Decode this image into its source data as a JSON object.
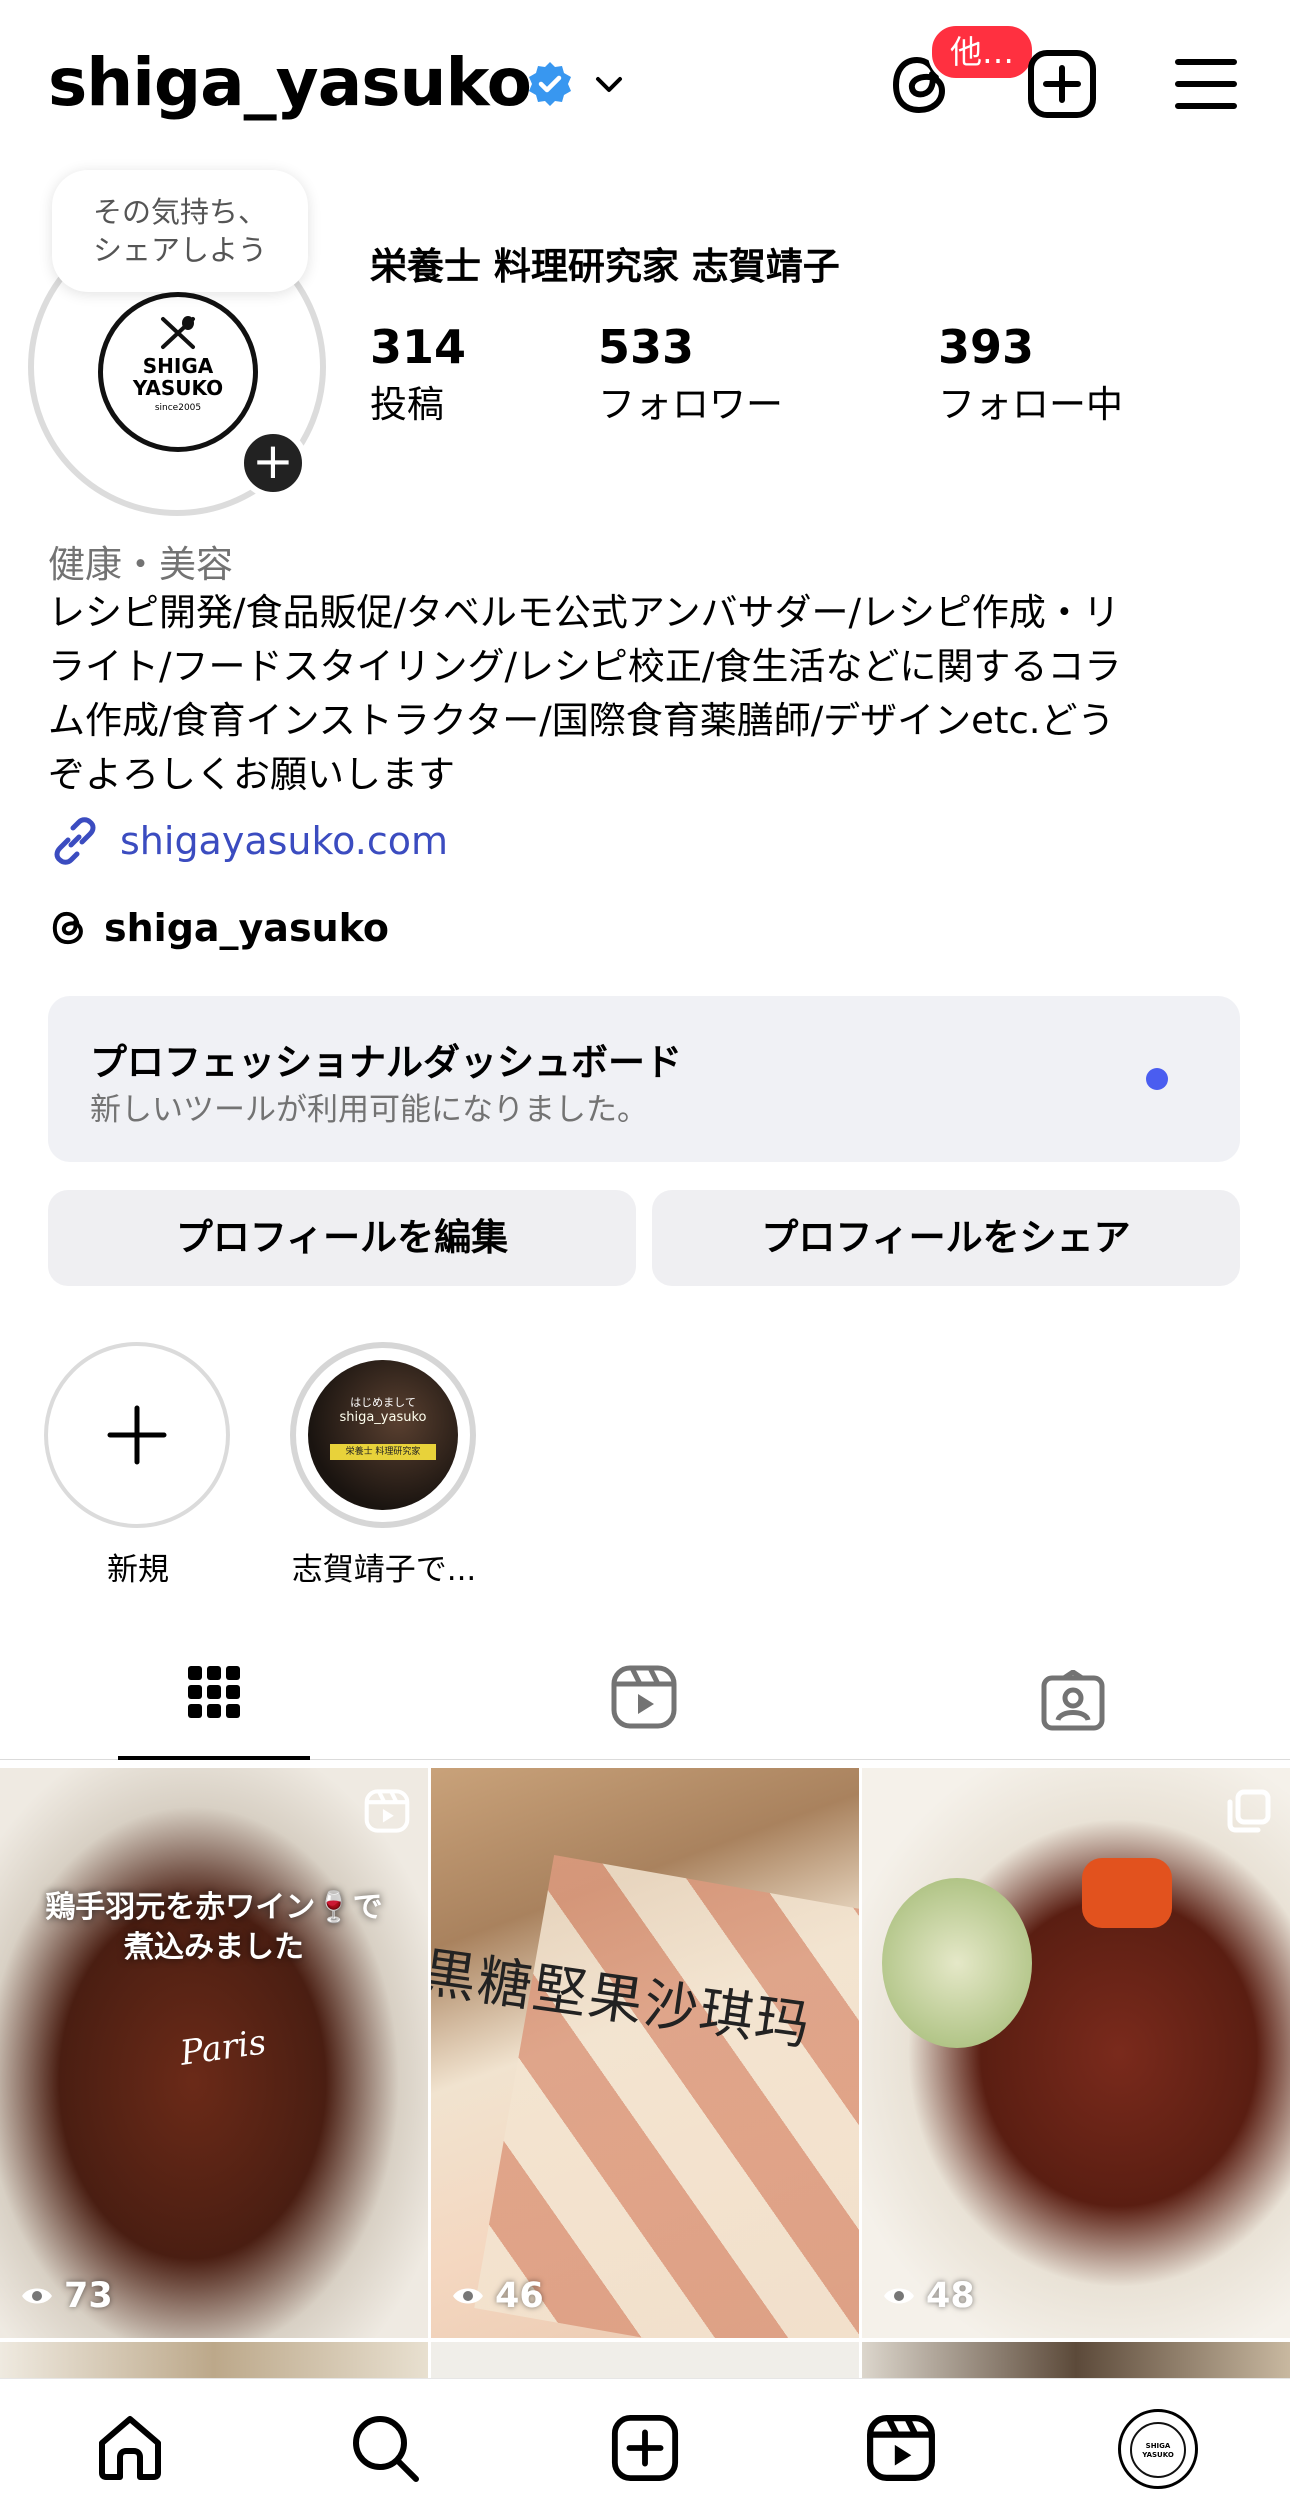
{
  "header": {
    "username": "shiga_yasuko",
    "threads_badge": "他…"
  },
  "note": {
    "line1": "その気持ち、",
    "line2": "シェアしよう"
  },
  "avatar": {
    "line1": "SHIGA",
    "line2": "YASUKO",
    "line3": "since2005"
  },
  "profile": {
    "display_name": "栄養士 料理研究家 志賀靖子",
    "stats": [
      {
        "value": "314",
        "label": "投稿"
      },
      {
        "value": "533",
        "label": "フォロワー"
      },
      {
        "value": "393",
        "label": "フォロー中"
      }
    ],
    "category": "健康・美容",
    "bio_lines": [
      "レシピ開発/食品販促/タベルモ公式アンバサダー/レシピ作成・リ",
      "ライト/フードスタイリング/レシピ校正/食生活などに関するコラ",
      "ム作成/食育インストラクター/国際食育薬膳師/デザインetc.どう",
      "ぞよろしくお願いします"
    ],
    "link": "shigayasuko.com",
    "threads_handle": "shiga_yasuko"
  },
  "dashboard": {
    "title": "プロフェッショナルダッシュボード",
    "subtitle": "新しいツールが利用可能になりました。"
  },
  "buttons": {
    "edit": "プロフィールを編集",
    "share": "プロフィールをシェア"
  },
  "highlights": [
    {
      "label": "新規"
    },
    {
      "label": "志賀靖子で..."
    }
  ],
  "highlight_thumb": {
    "line1": "はじめまして",
    "line2": "shiga_yasuko",
    "line3": "栄養士 料理研究家"
  },
  "posts": [
    {
      "views": "73",
      "overlay_line1": "鶏手羽元を赤ワイン🍷で",
      "overlay_line2": "煮込みました",
      "script": "Paris",
      "type": "reel"
    },
    {
      "views": "46",
      "package_text": "黒糖堅果沙琪玛",
      "type": "reel"
    },
    {
      "views": "48",
      "type": "carousel"
    }
  ],
  "accent": "#3b4cc0",
  "badge_color": "#ff3040"
}
